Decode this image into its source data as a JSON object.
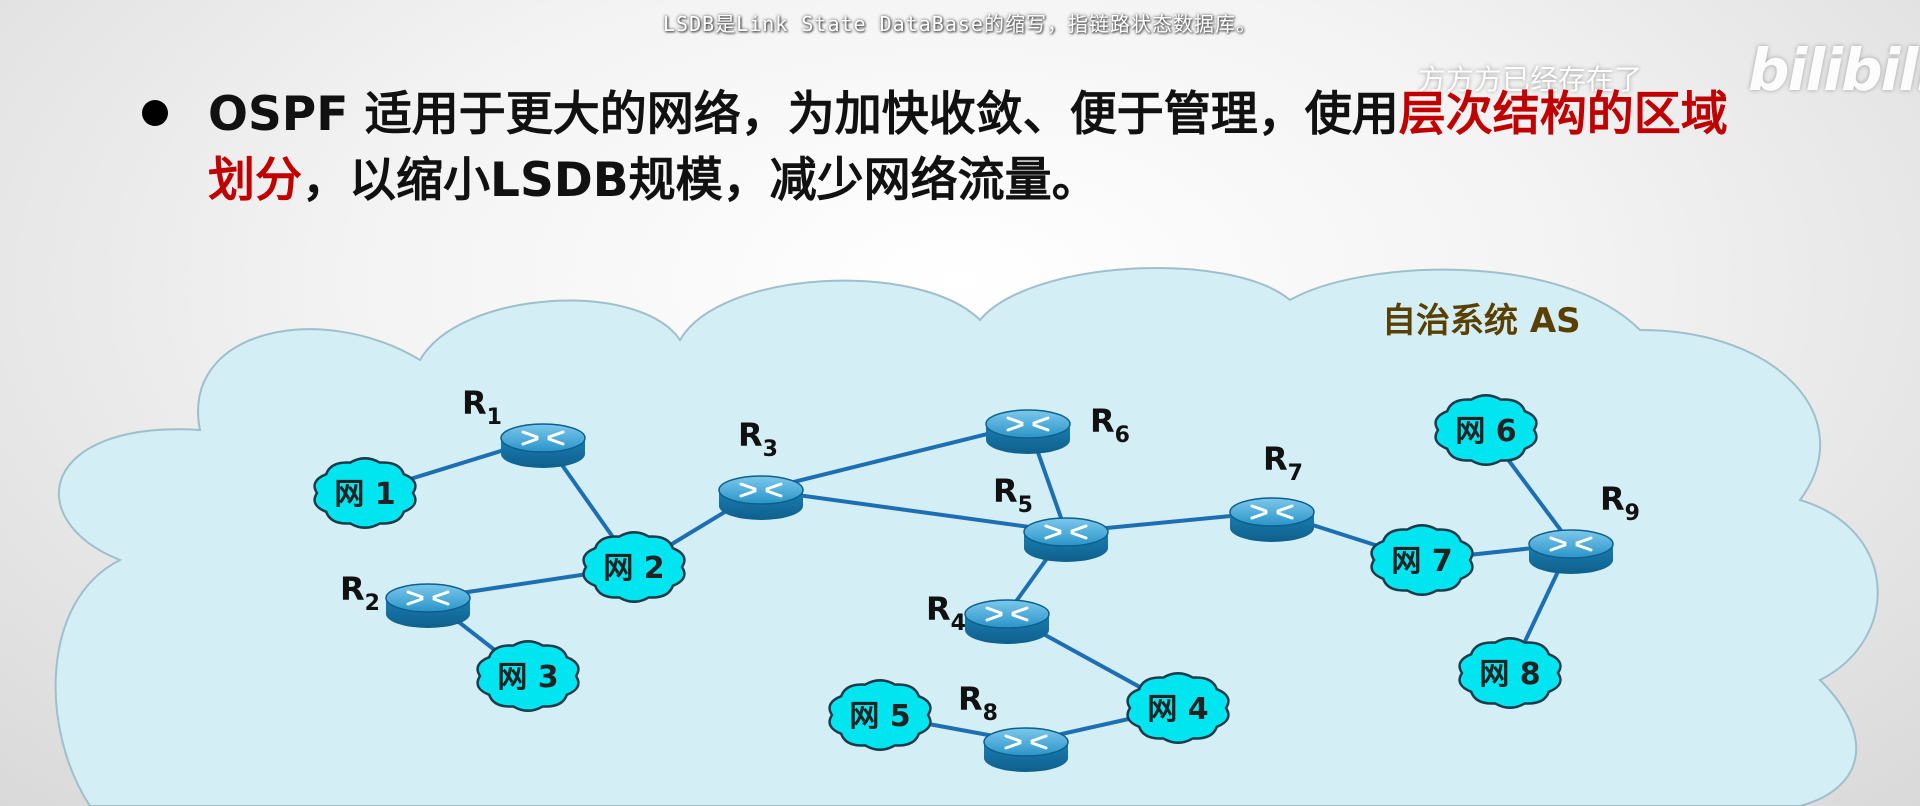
{
  "subtitle": "LSDB是Link State DataBase的缩写，指链路状态数据库。",
  "watermark": "方方方已经存在了",
  "logo": "bilibili",
  "heading": {
    "part1": "OSPF 适用于更大的网络，为加快收敛、便于管理，使用",
    "highlight": "层次结构的区域划分",
    "part2": "，以缩小LSDB规模，减少网络流量。"
  },
  "colors": {
    "highlight": "#c00000",
    "cloud": "#d4eef6",
    "network": "#00e5f0",
    "router": "#1f8fc4",
    "link": "#1d6fb3"
  },
  "diagram": {
    "as_label": "自治系统 AS",
    "routers": [
      {
        "id": "R1",
        "name": "R",
        "sub": "1"
      },
      {
        "id": "R2",
        "name": "R",
        "sub": "2"
      },
      {
        "id": "R3",
        "name": "R",
        "sub": "3"
      },
      {
        "id": "R4",
        "name": "R",
        "sub": "4"
      },
      {
        "id": "R5",
        "name": "R",
        "sub": "5"
      },
      {
        "id": "R6",
        "name": "R",
        "sub": "6"
      },
      {
        "id": "R7",
        "name": "R",
        "sub": "7"
      },
      {
        "id": "R8",
        "name": "R",
        "sub": "8"
      },
      {
        "id": "R9",
        "name": "R",
        "sub": "9"
      }
    ],
    "networks": [
      {
        "id": "N1",
        "label": "网 1"
      },
      {
        "id": "N2",
        "label": "网 2"
      },
      {
        "id": "N3",
        "label": "网 3"
      },
      {
        "id": "N4",
        "label": "网 4"
      },
      {
        "id": "N5",
        "label": "网 5"
      },
      {
        "id": "N6",
        "label": "网 6"
      },
      {
        "id": "N7",
        "label": "网 7"
      },
      {
        "id": "N8",
        "label": "网 8"
      }
    ],
    "links": [
      [
        "N1",
        "R1"
      ],
      [
        "R1",
        "N2"
      ],
      [
        "R2",
        "N2"
      ],
      [
        "R2",
        "N3"
      ],
      [
        "N2",
        "R3"
      ],
      [
        "R3",
        "R6"
      ],
      [
        "R3",
        "R5"
      ],
      [
        "R6",
        "R5"
      ],
      [
        "R5",
        "R7"
      ],
      [
        "R5",
        "R4"
      ],
      [
        "R4",
        "N4"
      ],
      [
        "N4",
        "R8"
      ],
      [
        "R8",
        "N5"
      ],
      [
        "R7",
        "N7"
      ],
      [
        "N7",
        "R9"
      ],
      [
        "N6",
        "R9"
      ],
      [
        "R9",
        "N8"
      ]
    ]
  }
}
